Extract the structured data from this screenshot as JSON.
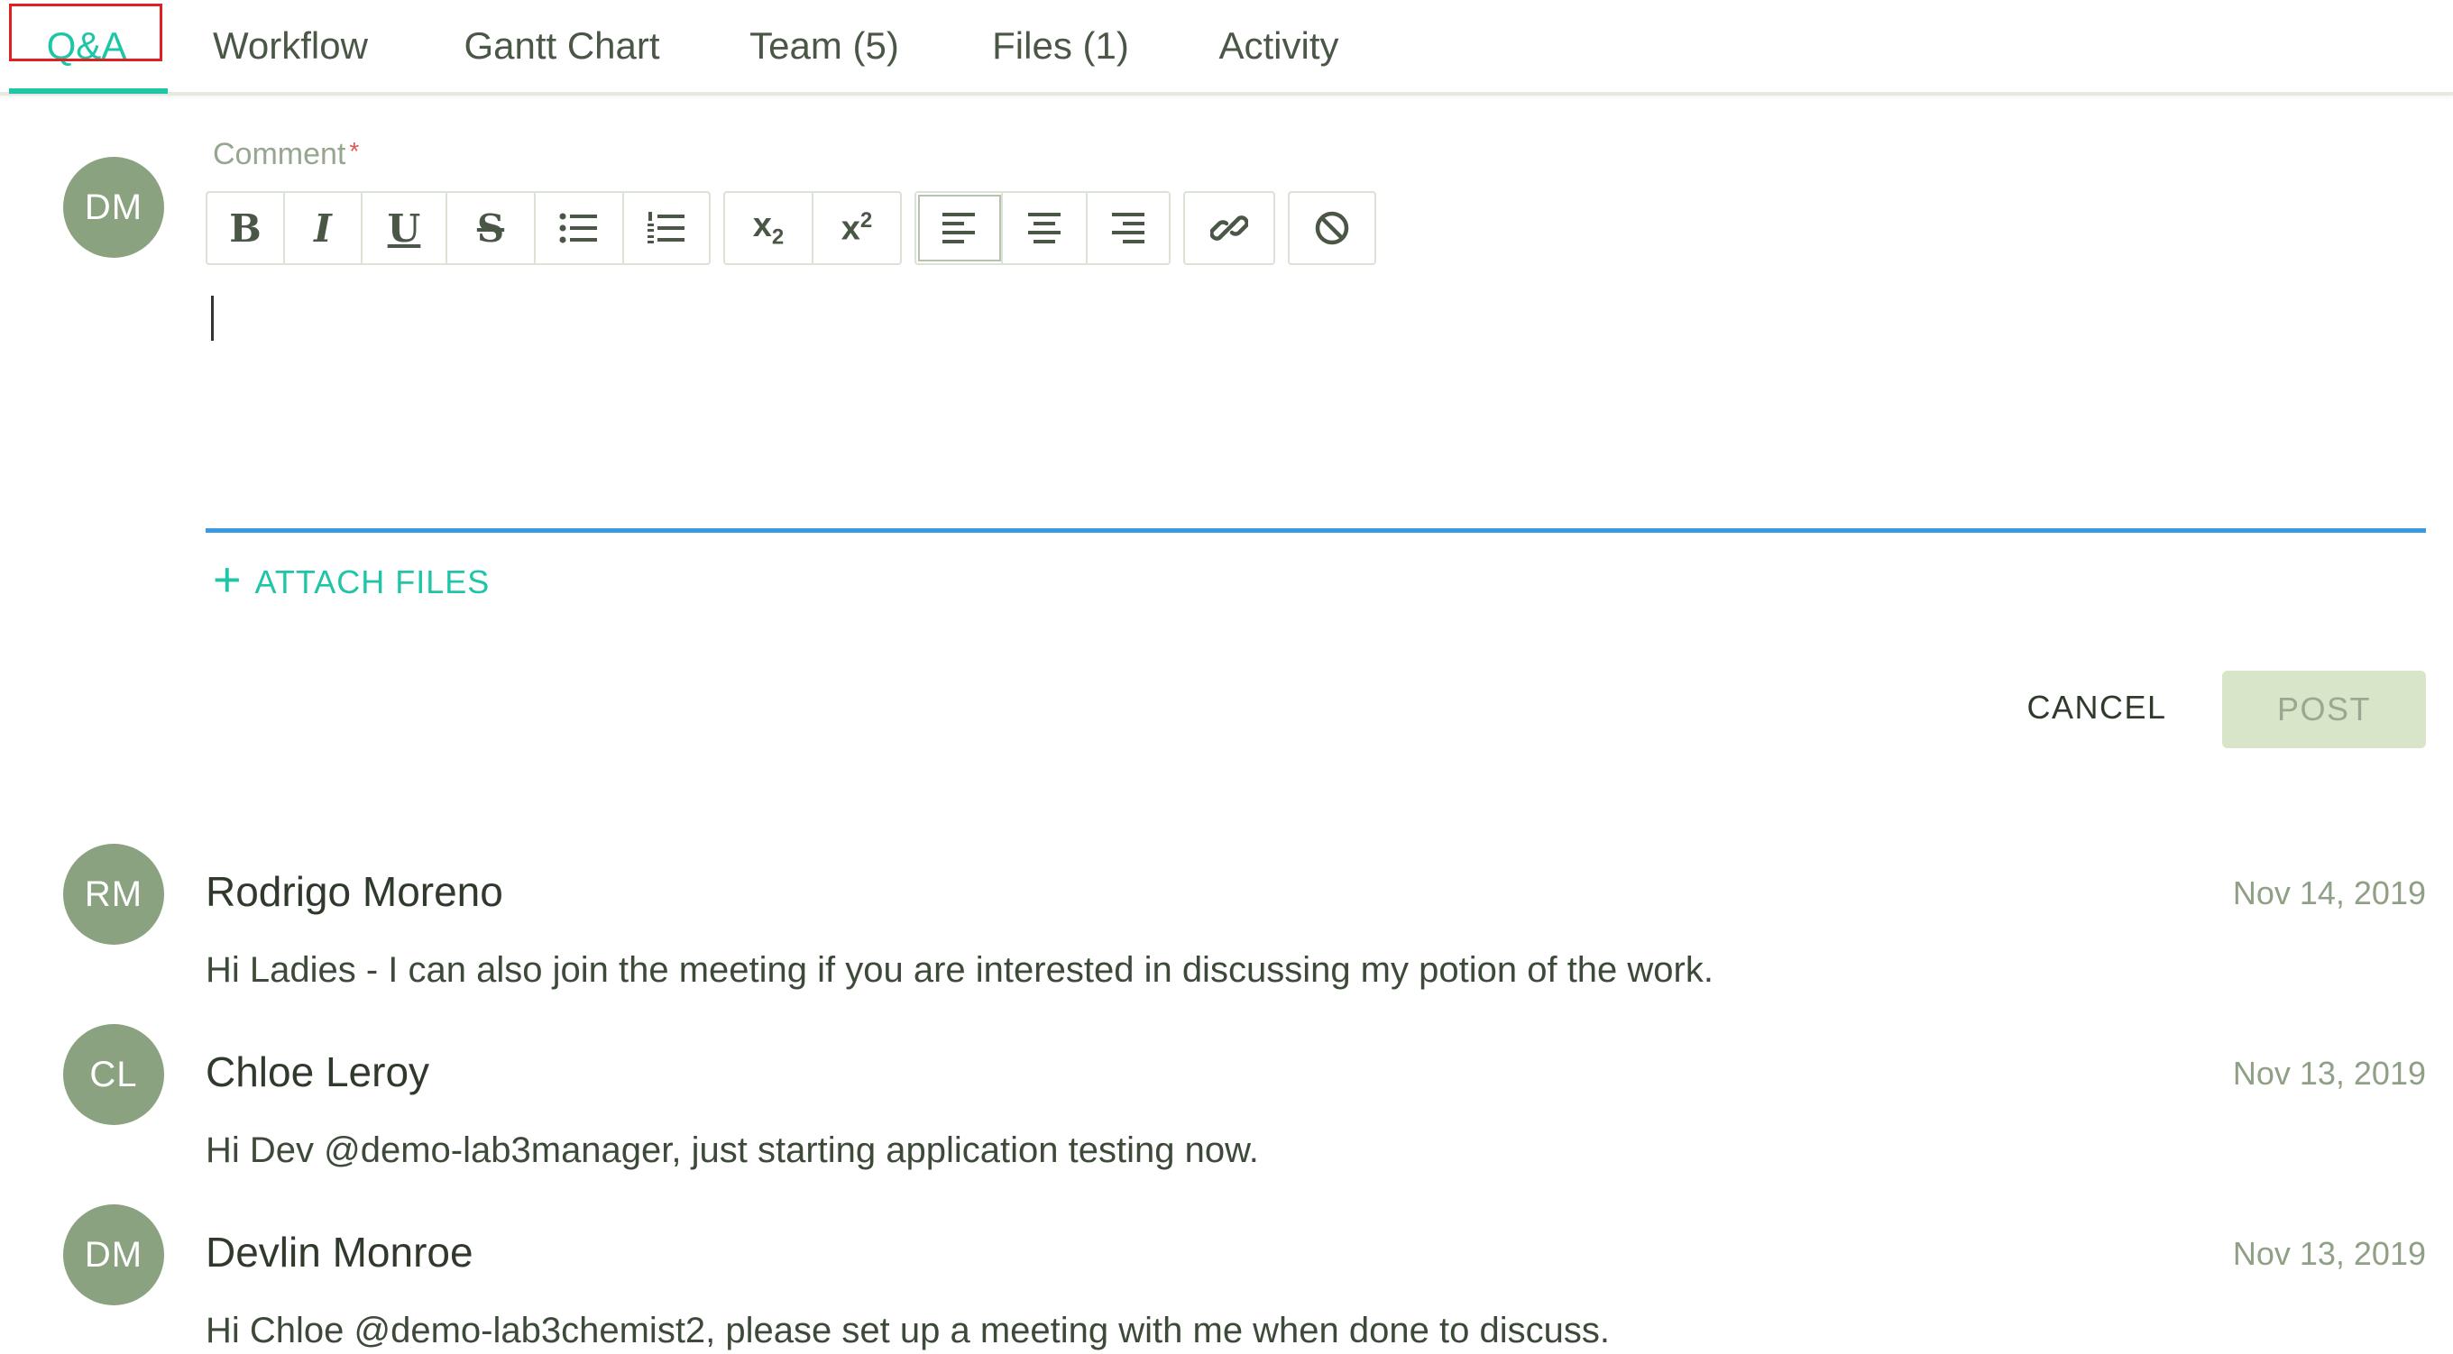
{
  "tabs": [
    {
      "label": "Q&A",
      "active": true
    },
    {
      "label": "Workflow",
      "active": false
    },
    {
      "label": "Gantt Chart",
      "active": false
    },
    {
      "label": "Team (5)",
      "active": false
    },
    {
      "label": "Files (1)",
      "active": false
    },
    {
      "label": "Activity",
      "active": false
    }
  ],
  "editor": {
    "user_initials": "DM",
    "label": "Comment",
    "required_mark": "*",
    "toolbar": {
      "bold": "B",
      "italic": "I",
      "underline": "U",
      "strike": "S",
      "subscript": "x",
      "subscript_index": "2",
      "superscript": "x",
      "superscript_index": "2",
      "icons": [
        "bold-icon",
        "italic-icon",
        "underline-icon",
        "strikethrough-icon",
        "bullet-list-icon",
        "numbered-list-icon",
        "subscript-icon",
        "superscript-icon",
        "align-left-icon",
        "align-center-icon",
        "align-right-icon",
        "link-icon",
        "clear-format-icon"
      ]
    },
    "value": "",
    "attach_label": "ATTACH FILES",
    "cancel_label": "CANCEL",
    "post_label": "POST"
  },
  "comments": [
    {
      "initials": "RM",
      "author": "Rodrigo Moreno",
      "date": "Nov 14, 2019",
      "text": "Hi Ladies - I can also join the meeting if you are interested in discussing my potion of the work."
    },
    {
      "initials": "CL",
      "author": "Chloe Leroy",
      "date": "Nov 13, 2019",
      "text": "Hi Dev @demo-lab3manager, just starting application testing now."
    },
    {
      "initials": "DM",
      "author": "Devlin Monroe",
      "date": "Nov 13, 2019",
      "text": "Hi Chloe @demo-lab3chemist2, please set up a meeting with me when done to discuss."
    }
  ],
  "colors": {
    "accent": "#1fc5a7",
    "avatar": "#8aa27f",
    "editor_focus_line": "#3b9ae1",
    "post_disabled_bg": "#d8e5c8",
    "highlight_box": "#e02020"
  }
}
